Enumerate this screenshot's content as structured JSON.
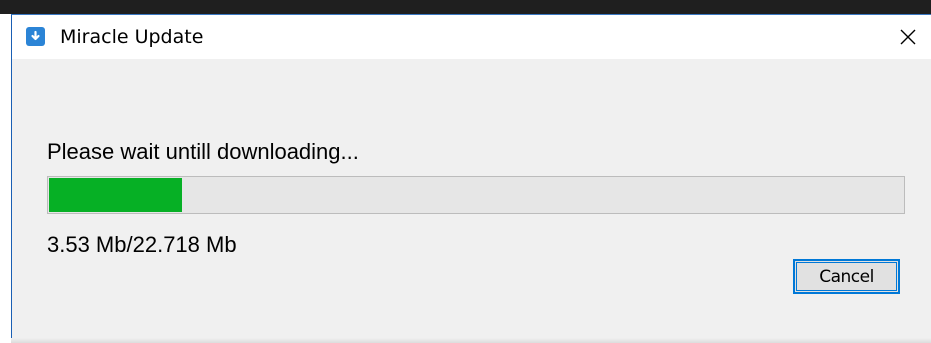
{
  "window": {
    "title": "Miracle Update",
    "close_symbol": "✕",
    "app_icon": "download-arrow-icon",
    "accent_color": "#2b84d6"
  },
  "download": {
    "status_text": "Please wait untill downloading...",
    "size_text": "3.53 Mb/22.718 Mb",
    "progress_fraction": 0.1554,
    "progress_color": "#06b025"
  },
  "buttons": {
    "cancel_label": "Cancel"
  }
}
